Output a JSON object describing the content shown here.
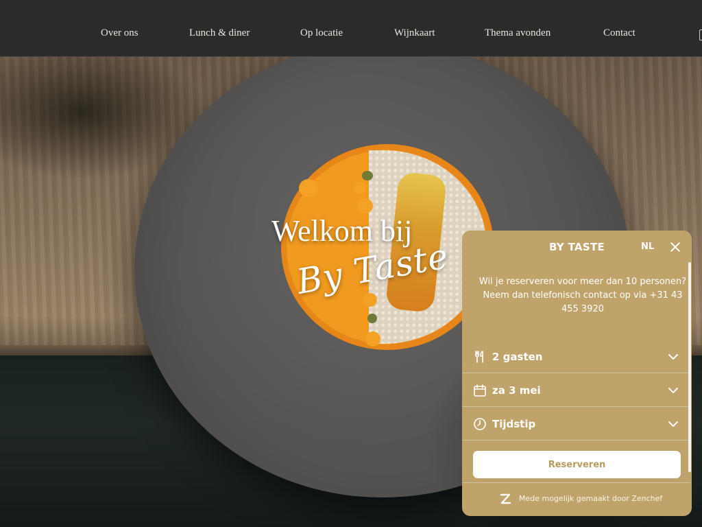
{
  "nav": {
    "items": [
      {
        "label": "Over ons"
      },
      {
        "label": "Lunch & diner"
      },
      {
        "label": "Op locatie"
      },
      {
        "label": "Wijnkaart"
      },
      {
        "label": "Thema avonden"
      },
      {
        "label": "Contact"
      }
    ]
  },
  "hero": {
    "title": "Welkom bij",
    "script": "By Taste"
  },
  "widget": {
    "title": "BY TASTE",
    "language": "NL",
    "info": "Wil je reserveren voor meer dan 10 personen? Neem dan telefonisch contact op via +31 43 455 3920",
    "fields": {
      "guests": "2 gasten",
      "date": "za 3 mei",
      "time": "Tijdstip"
    },
    "button_label": "Reserveren",
    "footer": "Mede mogelijk gemaakt door Zenchef"
  },
  "colors": {
    "nav_bg": "#2b2b2b",
    "widget_bg": "#bfa36a",
    "button_text": "#b89a5e"
  },
  "icons": [
    "utensils-icon",
    "calendar-icon",
    "clock-icon",
    "chevron-down-icon",
    "close-icon",
    "zenchef-logo-icon"
  ]
}
